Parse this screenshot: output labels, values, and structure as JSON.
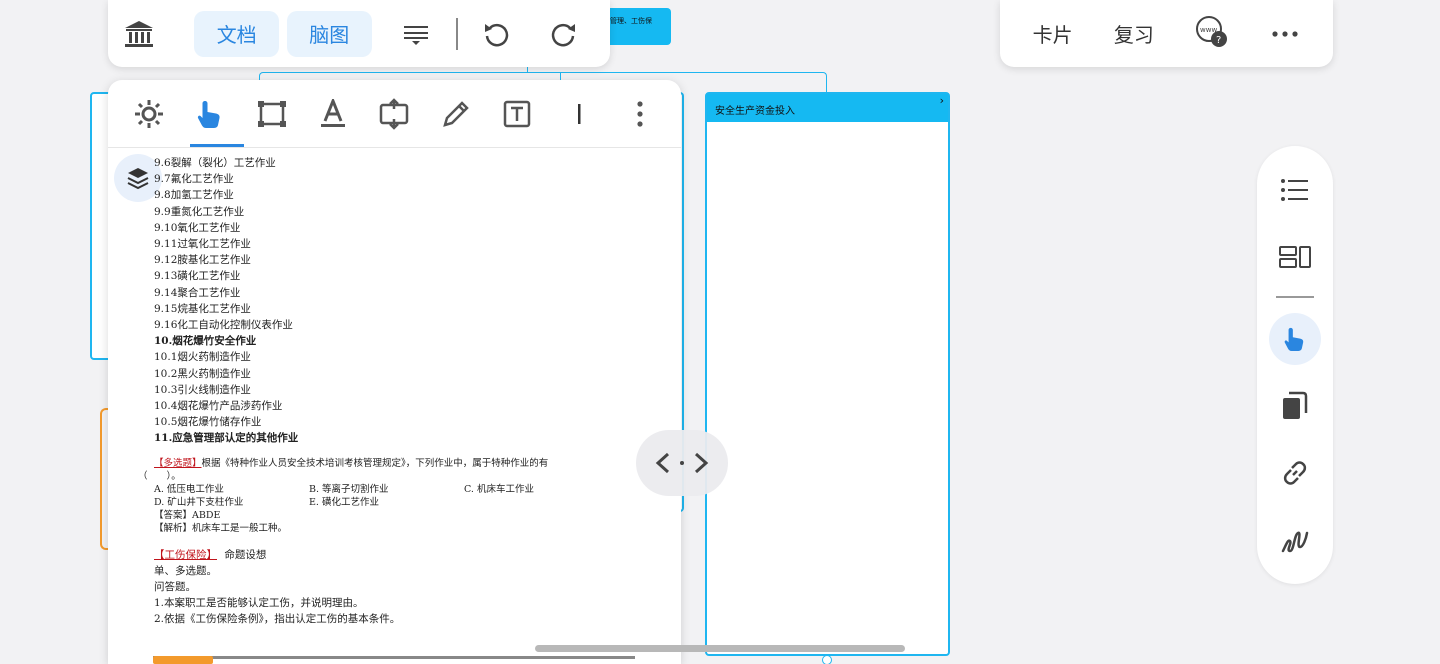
{
  "top_toolbar": {
    "tab_document": "文档",
    "tab_mindmap": "脑图"
  },
  "right_toolbar": {
    "card_label": "卡片",
    "review_label": "复习"
  },
  "bg_top_card_text": "管理、工伤保",
  "right_card": {
    "title": "安全生产资金投入",
    "chevron": "›"
  },
  "document": {
    "lines": [
      {
        "text": "9.6裂解（裂化）工艺作业",
        "bold": false
      },
      {
        "text": "9.7氟化工艺作业",
        "bold": false
      },
      {
        "text": "9.8加氢工艺作业",
        "bold": false
      },
      {
        "text": "9.9重氮化工艺作业",
        "bold": false
      },
      {
        "text": "9.10氧化工艺作业",
        "bold": false
      },
      {
        "text": "9.11过氧化工艺作业",
        "bold": false
      },
      {
        "text": "9.12胺基化工艺作业",
        "bold": false
      },
      {
        "text": "9.13磺化工艺作业",
        "bold": false
      },
      {
        "text": "9.14聚合工艺作业",
        "bold": false
      },
      {
        "text": "9.15烷基化工艺作业",
        "bold": false
      },
      {
        "text": "9.16化工自动化控制仪表作业",
        "bold": false
      },
      {
        "text": "10.烟花爆竹安全作业",
        "bold": true
      },
      {
        "text": "10.1烟火药制造作业",
        "bold": false
      },
      {
        "text": "10.2黑火药制造作业",
        "bold": false
      },
      {
        "text": "10.3引火线制造作业",
        "bold": false
      },
      {
        "text": "10.4烟花爆竹产品涉药作业",
        "bold": false
      },
      {
        "text": "10.5烟花爆竹储存作业",
        "bold": false
      },
      {
        "text": "11.应急管理部认定的其他作业",
        "bold": true
      }
    ],
    "question_tag": "【多选题】",
    "question_text": "根据《特种作业人员安全技术培训考核管理规定》，下列作业中，属于特种作业的有",
    "question_paren": "（　　）。",
    "options_row1": [
      "A. 低压电工作业",
      "B. 等离子切割作业",
      "C. 机床车工作业"
    ],
    "options_row2": [
      "D. 矿山井下支柱作业",
      "E. 磺化工艺作业"
    ],
    "answer": "【答案】ABDE",
    "analysis": "【解析】机床车工是一般工种。",
    "section_tag": "【工伤保险】",
    "section_title": "命题设想",
    "section_lines": [
      "单、多选题。",
      "问答题。",
      "1.本案职工是否能够认定工伤，并说明理由。",
      "2.依据《工伤保险条例》，指出认定工伤的基本条件。"
    ]
  },
  "colors": {
    "accent_blue": "#2a86e0",
    "card_cyan": "#15b9f2",
    "emphasis_red": "#c0141c",
    "orange": "#f39a2c"
  }
}
